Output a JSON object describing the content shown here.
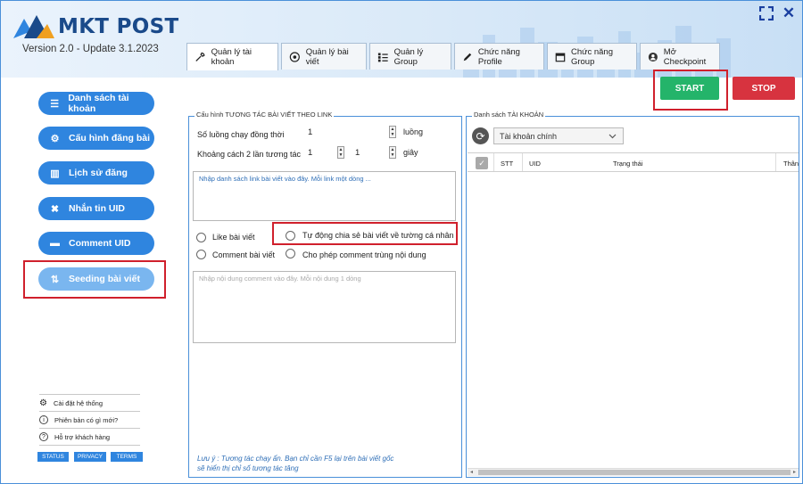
{
  "app": {
    "logo_text": "MKT POST",
    "version": "Version 2.0 - Update 3.1.2023"
  },
  "window_controls": {
    "expand_icon": "expand-icon",
    "close_icon": "close-icon",
    "close_glyph": "✕"
  },
  "tabs": [
    {
      "label": "Quản lý tài khoản",
      "icon": "wrench-icon"
    },
    {
      "label": "Quản lý bài viết",
      "icon": "target-icon"
    },
    {
      "label": "Quản lý Group",
      "icon": "list-icon"
    },
    {
      "label": "Chức năng Profile",
      "icon": "pencil-icon"
    },
    {
      "label": "Chức năng Group",
      "icon": "calendar-icon"
    },
    {
      "label": "Mở Checkpoint",
      "icon": "user-icon"
    }
  ],
  "actions": {
    "start": "START",
    "stop": "STOP"
  },
  "sidebar": {
    "items": [
      {
        "label": "Danh sách tài khoản",
        "icon": "list-icon"
      },
      {
        "label": "Cấu hình đăng bài",
        "icon": "gears-icon"
      },
      {
        "label": "Lịch sử đăng",
        "icon": "book-icon"
      },
      {
        "label": "Nhắn tin UID",
        "icon": "message-icon"
      },
      {
        "label": "Comment UID",
        "icon": "comment-icon"
      },
      {
        "label": "Seeding bài viết",
        "icon": "seeding-icon"
      }
    ],
    "footer": [
      {
        "label": "Cài đặt hệ thống",
        "icon": "gear-icon"
      },
      {
        "label": "Phiên bản có gì mới?",
        "icon": "info-icon"
      },
      {
        "label": "Hỗ trợ khách hàng",
        "icon": "help-icon"
      }
    ],
    "mini_buttons": [
      "STATUS",
      "PRIVACY",
      "TERMS"
    ]
  },
  "config": {
    "title": "Cấu hình TƯƠNG TÁC BÀI VIẾT THEO LINK",
    "threads_label": "Số luồng chạy đồng thời",
    "threads_value": "1",
    "threads_unit": "luồng",
    "interval_label": "Khoảng cách 2 lần tương tác",
    "interval_from": "1",
    "interval_to": "1",
    "interval_unit": "giây",
    "links_placeholder": "Nhập danh sách link bài viết vào đây. Mỗi link một dòng ...",
    "like_label": "Like bài viết",
    "share_label": "Tự động chia sẻ bài viết về tường cá nhân",
    "comment_label": "Comment bài viết",
    "dup_comment_label": "Cho phép comment trùng nội dung",
    "comment_placeholder": "Nhập nội dung comment vào đây. Mỗi nội dung 1 dòng",
    "note_line1": "Lưu ý : Tương tác chạy ẩn. Bạn chỉ cần F5 lại trên bài viết gốc",
    "note_line2": "sẽ hiển thị chỉ số tương tác tăng"
  },
  "accounts": {
    "title": "Danh sách TÀI KHOẢN",
    "filter_value": "Tài khoản chính",
    "columns": [
      "STT",
      "UID",
      "Trạng thái",
      "Thân"
    ]
  },
  "colors": {
    "accent": "#2f85df",
    "start": "#24b46a",
    "stop": "#d7333f",
    "highlight": "#d0202c"
  }
}
